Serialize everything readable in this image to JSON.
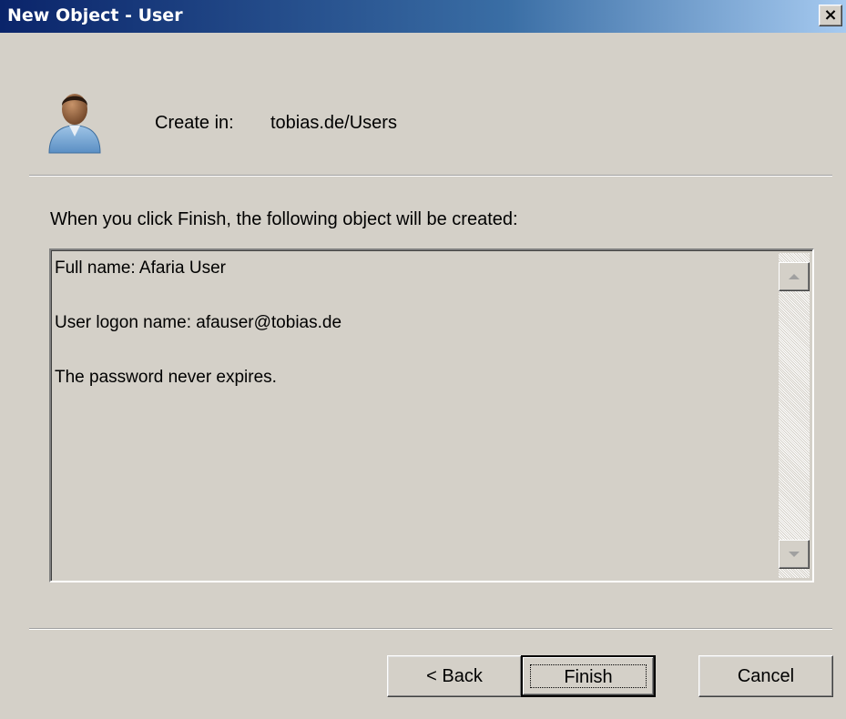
{
  "window": {
    "title": "New Object - User",
    "close_glyph": "✕"
  },
  "header": {
    "icon": "user-icon",
    "create_in_label": "Create in:",
    "create_in_value": "tobias.de/Users"
  },
  "instruction": "When you click Finish, the following object will be created:",
  "summary": {
    "lines": [
      "Full name: Afaria User",
      "User logon name: afauser@tobias.de",
      "The password never expires."
    ]
  },
  "buttons": {
    "back": "< Back",
    "finish": "Finish",
    "cancel": "Cancel"
  },
  "colors": {
    "dialog_bg": "#d4d0c8",
    "titlebar_start": "#0a246a",
    "titlebar_end": "#a6caf0"
  }
}
